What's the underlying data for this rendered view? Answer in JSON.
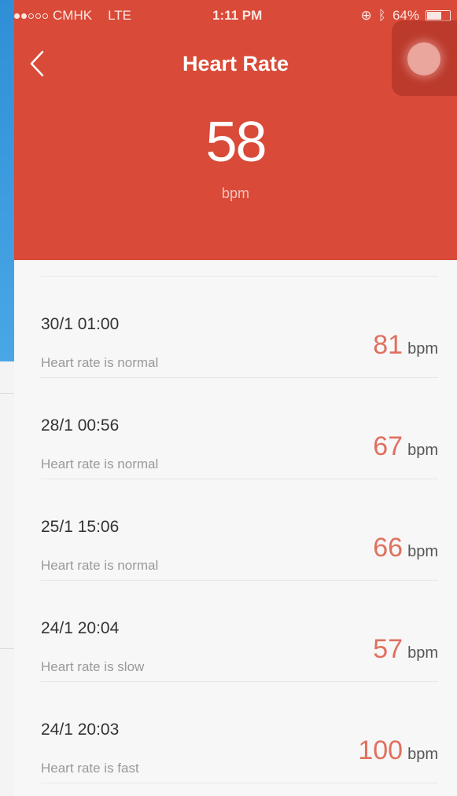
{
  "status_bar": {
    "carrier": "CMHK",
    "network": "LTE",
    "time": "1:11 PM",
    "battery": "64%"
  },
  "header": {
    "title": "Heart Rate",
    "current_value": "58",
    "current_unit": "bpm"
  },
  "colors": {
    "header_bg": "#d94a38",
    "value_accent": "#e0705f"
  },
  "records": [
    {
      "date": "30/1 01:00",
      "status": "Heart rate is normal",
      "value": "81",
      "unit": "bpm"
    },
    {
      "date": "28/1 00:56",
      "status": "Heart rate is normal",
      "value": "67",
      "unit": "bpm"
    },
    {
      "date": "25/1 15:06",
      "status": "Heart rate is normal",
      "value": "66",
      "unit": "bpm"
    },
    {
      "date": "24/1 20:04",
      "status": "Heart rate is slow",
      "value": "57",
      "unit": "bpm"
    },
    {
      "date": "24/1 20:03",
      "status": "Heart rate is fast",
      "value": "100",
      "unit": "bpm"
    }
  ]
}
